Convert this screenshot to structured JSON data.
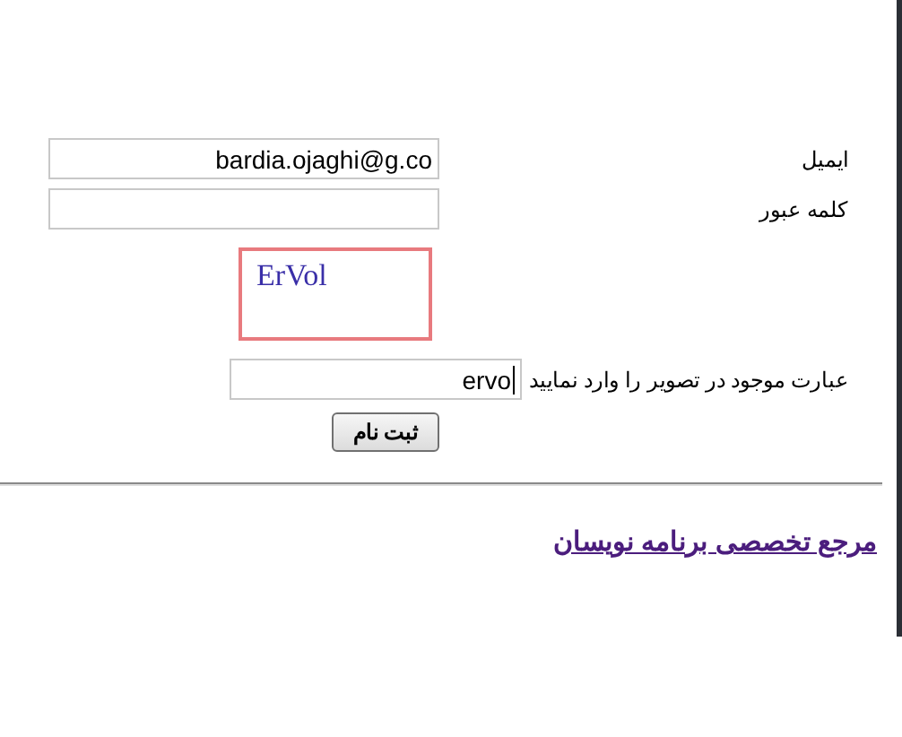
{
  "form": {
    "fields": [
      {
        "kind": "text",
        "label": "ایمیل",
        "value": "bardia.ojaghi@g.co"
      },
      {
        "kind": "password",
        "label": "کلمه عبور"
      }
    ],
    "captcha": {
      "image_text": "ErVol",
      "label": "عبارت موجود در تصویر را وارد نمایید",
      "value": "ervo",
      "focused": true
    },
    "submit_button": "ثبت نام"
  },
  "footer_link": "مرجع تخصصی برنامه نویسان"
}
